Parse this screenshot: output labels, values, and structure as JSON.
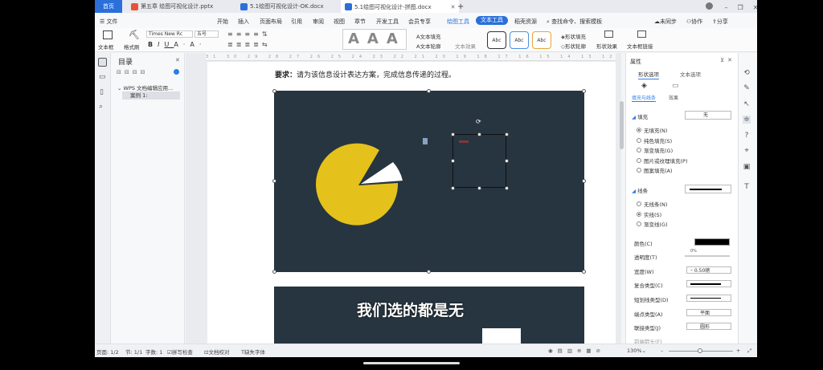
{
  "tabs": {
    "home": "首页",
    "t1": "第五章 绘图可视化设计.pptx",
    "t2": "5.1绘图可视化设计-OK.docx",
    "t3": "5.1绘图可视化设计-拼图.docx",
    "plus": "+"
  },
  "menu": {
    "file": "文件",
    "items": [
      "开始",
      "插入",
      "页面布局",
      "引用",
      "审阅",
      "视图",
      "章节",
      "开发工具",
      "会员专享"
    ],
    "drawing_tools": "绘图工具",
    "text_tools": "文本工具",
    "resource": "稻壳资源",
    "search": "查找命令、搜索模板",
    "unsync": "未同步",
    "collab": "协作",
    "share": "分享"
  },
  "ribbon": {
    "textbox": "文本框",
    "format_painter": "格式刷",
    "font": "Times New Rc",
    "size": "五号",
    "text_fill": "文本填充",
    "text_outline": "文本轮廓",
    "text_effect": "文本效果",
    "style_abc": "Abc",
    "shape_fill": "形状填充",
    "shape_outline": "形状轮廓",
    "shape_effect": "形状效果",
    "text_link": "文本框链接"
  },
  "toc": {
    "title": "目录",
    "item": "WPS 文档编辑应用...",
    "sub": "案例 1:"
  },
  "doc": {
    "requirement_bold": "要求：",
    "requirement": "请为该信息设计表达方案，完成信息传递的过程。",
    "subtitle": "我们选的都是无"
  },
  "panel": {
    "title": "属性",
    "tab_shape": "形状选项",
    "tab_text": "文本选项",
    "sub_fill": "填充与线条",
    "sub_effect": "效果",
    "fill_label": "填充",
    "fill_value": "无",
    "fill_options": [
      "无填充(N)",
      "纯色填充(S)",
      "渐变填充(G)",
      "图片或纹理填充(P)",
      "图案填充(A)"
    ],
    "line_label": "线条",
    "line_options": [
      "无线条(N)",
      "实线(S)",
      "渐变线(G)"
    ],
    "color": "颜色(C)",
    "transparency": "透明度(T)",
    "transparency_val": "0%",
    "width": "宽度(W)",
    "width_val": "0.50磅",
    "compound": "复合类型(C)",
    "dash": "短划线类型(D)",
    "cap": "端点类型(A)",
    "cap_val": "平面",
    "join": "联接类型(J)",
    "join_val": "圆形",
    "more": "前端箭头(F)"
  },
  "status": {
    "page": "页面: 1/2",
    "section": "节: 1/1",
    "words": "字数: 1",
    "spell": "拼写检查",
    "proof": "文档校对",
    "font_missing": "缺失字体",
    "zoom": "130%"
  },
  "colors": {
    "slide_bg": "#263540",
    "pie": "#e5c11b",
    "accent": "#2b7de9"
  }
}
